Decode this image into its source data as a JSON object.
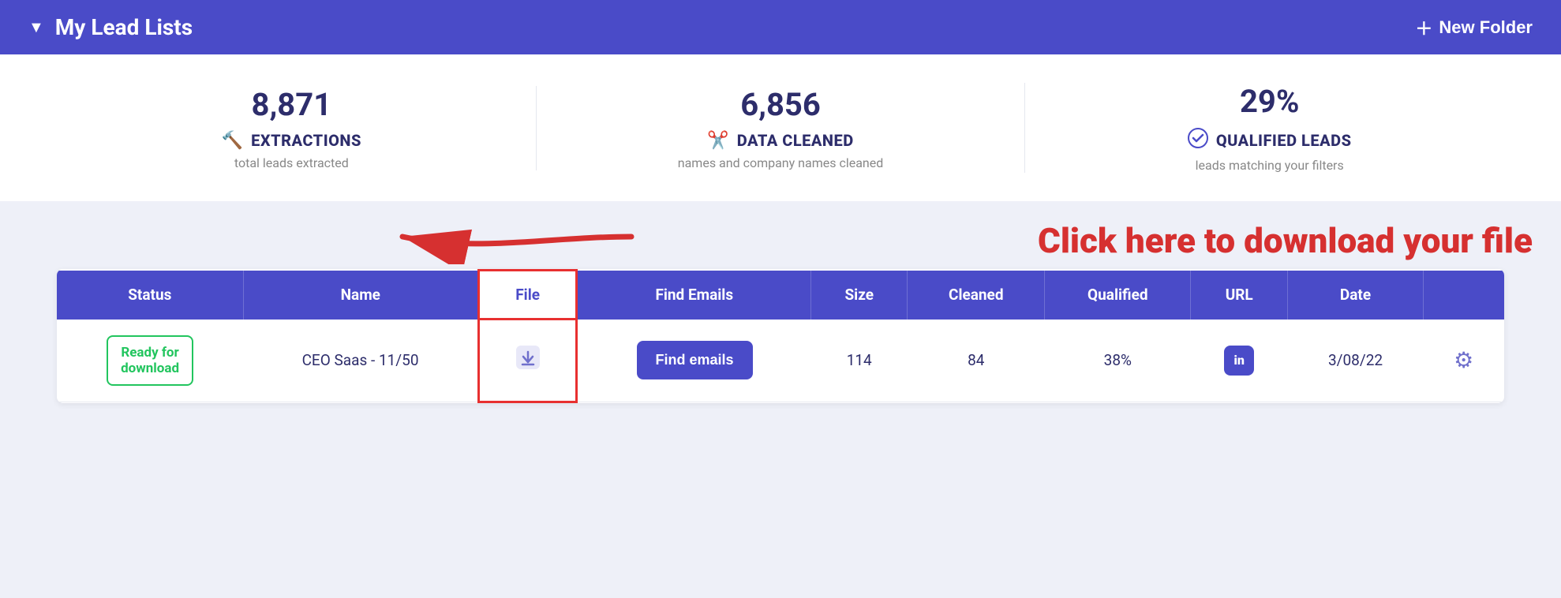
{
  "header": {
    "title": "My Lead Lists",
    "new_folder_label": "New Folder",
    "chevron": "▼"
  },
  "stats": [
    {
      "number": "8,871",
      "label": "EXTRACTIONS",
      "sub": "total leads extracted",
      "icon": "🔨"
    },
    {
      "number": "6,856",
      "label": "DATA CLEANED",
      "sub": "names and company names cleaned",
      "icon": "✂️"
    },
    {
      "number": "29%",
      "label": "QUALIFIED LEADS",
      "sub": "leads matching your filters",
      "icon": "✔"
    }
  ],
  "annotation": {
    "text": "Click here to download your file"
  },
  "table": {
    "columns": [
      "Status",
      "Name",
      "File",
      "Find Emails",
      "Size",
      "Cleaned",
      "Qualified",
      "URL",
      "Date",
      ""
    ],
    "rows": [
      {
        "status": "Ready for\ndownload",
        "name": "CEO Saas - 11/50",
        "size": "114",
        "cleaned": "84",
        "qualified": "38%",
        "date": "3/08/22"
      }
    ]
  }
}
